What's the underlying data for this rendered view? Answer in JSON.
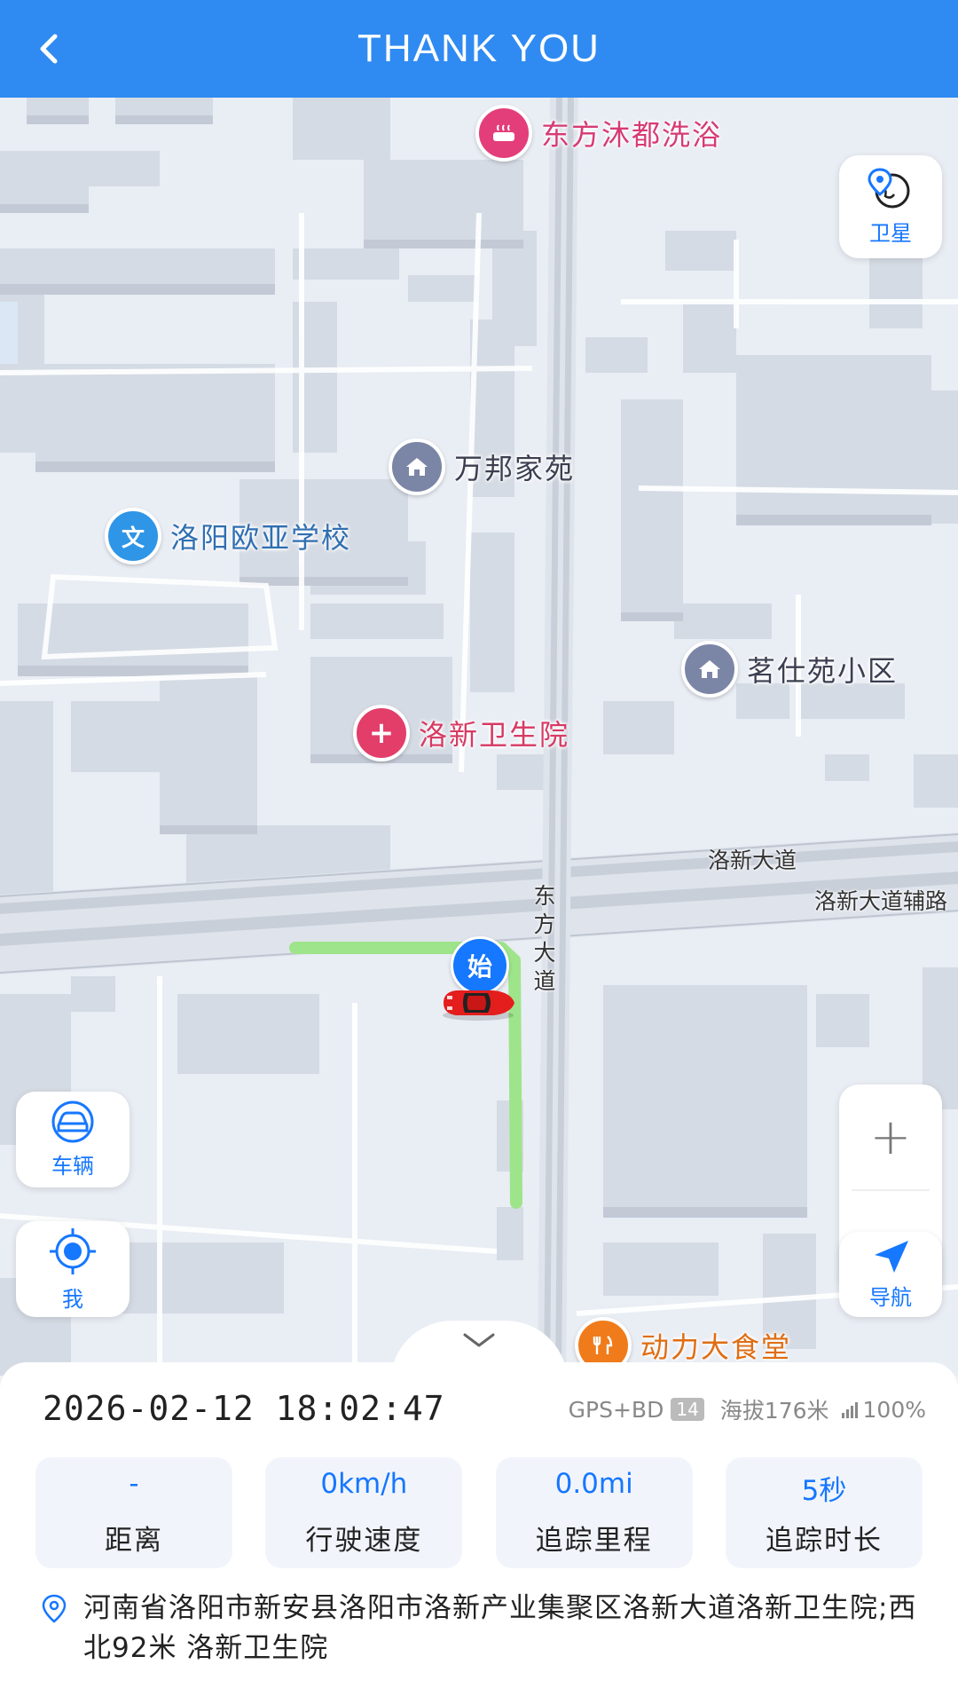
{
  "header": {
    "title": "THANK YOU",
    "back_icon": "chevron-left-icon"
  },
  "map": {
    "pois": [
      {
        "label": "东方沐都洗浴",
        "icon": "bath-icon",
        "color": "#e33d7a",
        "text_color": "#d73a73"
      },
      {
        "label": "万邦家苑",
        "icon": "residence-icon",
        "color": "#7b86a6",
        "text_color": "#3b3f50"
      },
      {
        "label": "洛阳欧亚学校",
        "icon": "school-icon",
        "glyph": "文",
        "color": "#2f95e6",
        "text_color": "#2f6fb1"
      },
      {
        "label": "茗仕苑小区",
        "icon": "residence-icon",
        "color": "#7b86a6",
        "text_color": "#3b3f50"
      },
      {
        "label": "洛新卫生院",
        "icon": "hospital-icon",
        "glyph": "+",
        "color": "#e33d6a",
        "text_color": "#d73a63"
      },
      {
        "label": "动力大食堂",
        "icon": "restaurant-icon",
        "color": "#f07b1a",
        "text_color": "#e06d12"
      }
    ],
    "road_labels": {
      "luoxin_avenue": "洛新大道",
      "luoxin_avenue_service": "洛新大道辅路",
      "dongfang_avenue": "东方大道"
    },
    "start_marker": "始",
    "satellite_label": "卫星",
    "vehicle_label": "车辆",
    "me_label": "我",
    "navigate_label": "导航",
    "zoom_in": "+",
    "zoom_out": "−",
    "route_color": "#9ee48a"
  },
  "panel": {
    "datetime": "2026-02-12 18:02:47",
    "gps_label": "GPS+BD",
    "satellites": "14",
    "altitude": "海拔176米",
    "battery": "100%",
    "stats": [
      {
        "value": "-",
        "label": "距离"
      },
      {
        "value": "0km/h",
        "label": "行驶速度"
      },
      {
        "value": "0.0mi",
        "label": "追踪里程"
      },
      {
        "value": "5秒",
        "label": "追踪时长"
      }
    ],
    "address": "河南省洛阳市新安县洛阳市洛新产业集聚区洛新大道洛新卫生院;西北92米 洛新卫生院"
  },
  "colors": {
    "accent": "#2f8bf1",
    "link_blue": "#1677ff"
  }
}
